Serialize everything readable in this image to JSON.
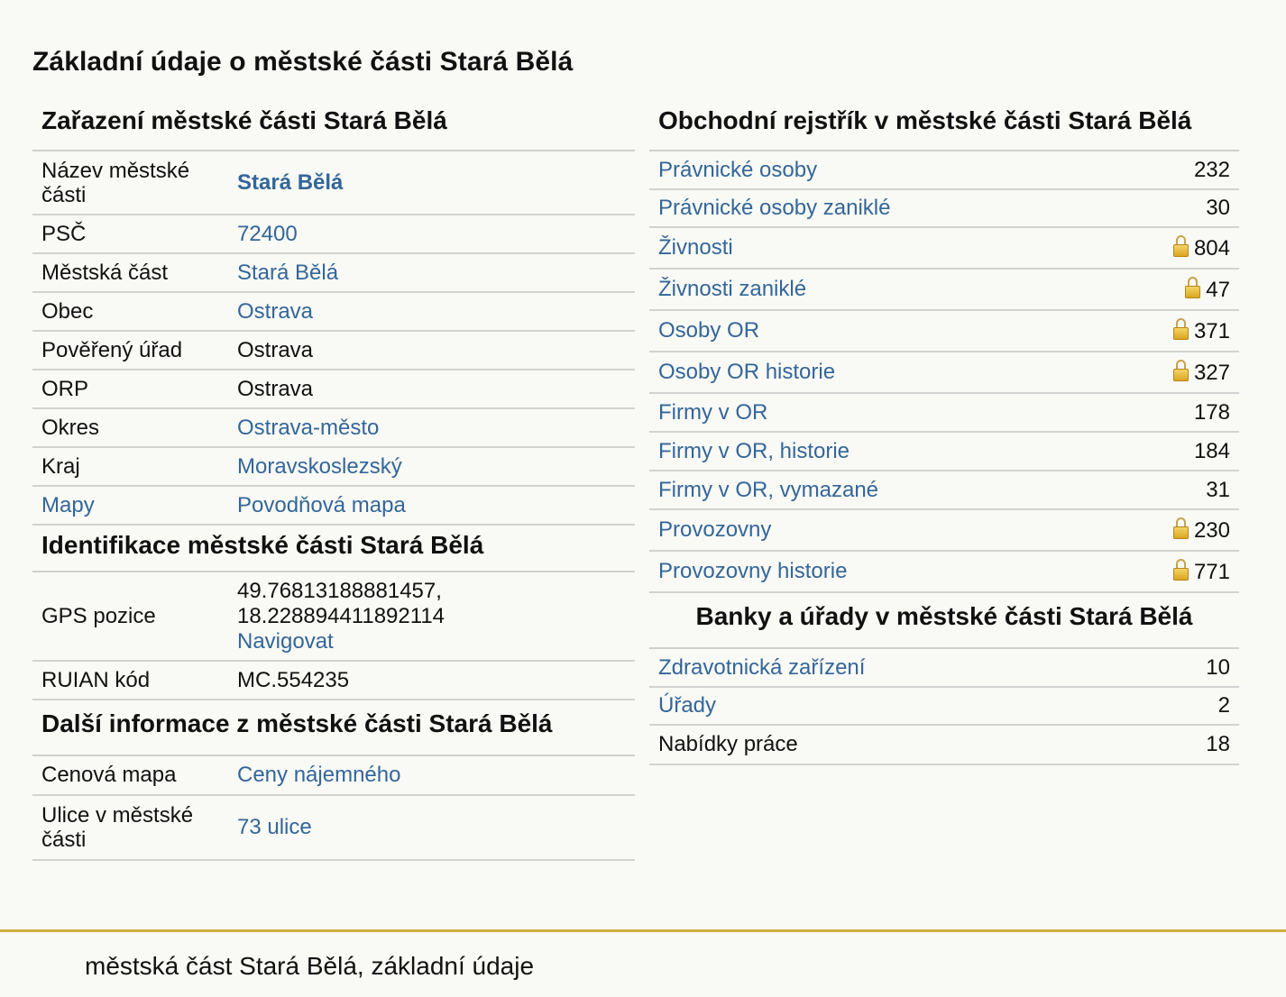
{
  "page_title": "Základní údaje o městské části Stará Bělá",
  "zarazeni": {
    "title": "Zařazení městské části Stará Bělá",
    "rows": [
      {
        "label": "Název městské části",
        "value": "Stará Bělá",
        "label_link": false,
        "value_link": true,
        "bold": true
      },
      {
        "label": "PSČ",
        "value": "72400",
        "label_link": false,
        "value_link": true
      },
      {
        "label": "Městská část",
        "value": "Stará Bělá",
        "label_link": false,
        "value_link": true
      },
      {
        "label": "Obec",
        "value": "Ostrava",
        "label_link": false,
        "value_link": true
      },
      {
        "label": "Pověřený úřad",
        "value": "Ostrava",
        "label_link": false,
        "value_link": false
      },
      {
        "label": "ORP",
        "value": "Ostrava",
        "label_link": false,
        "value_link": false
      },
      {
        "label": "Okres",
        "value": "Ostrava-město",
        "label_link": false,
        "value_link": true
      },
      {
        "label": "Kraj",
        "value": "Moravskoslezský",
        "label_link": false,
        "value_link": true
      },
      {
        "label": "Mapy",
        "value": "Povodňová mapa",
        "label_link": true,
        "value_link": true
      }
    ]
  },
  "identifikace": {
    "title": "Identifikace městské části Stará Bělá",
    "gps_label": "GPS pozice",
    "gps_lat": "49.76813188881457,",
    "gps_lon": "18.228894411892114",
    "navigate_label": "Navigovat",
    "ruian_label": "RUIAN kód",
    "ruian_value": "MC.554235"
  },
  "dalsi": {
    "title": "Další informace z městské části Stará Bělá",
    "rows": [
      {
        "label": "Cenová mapa",
        "value": "Ceny nájemného"
      },
      {
        "label": "Ulice v městské části",
        "value": "73 ulice"
      }
    ]
  },
  "rejstrik": {
    "title": "Obchodní rejstřík v městské části Stará Bělá",
    "rows": [
      {
        "label": "Právnické osoby",
        "count": "232",
        "locked": false
      },
      {
        "label": "Právnické osoby zaniklé",
        "count": "30",
        "locked": false
      },
      {
        "label": "Živnosti",
        "count": "804",
        "locked": true
      },
      {
        "label": "Živnosti zaniklé",
        "count": "47",
        "locked": true
      },
      {
        "label": "Osoby OR",
        "count": "371",
        "locked": true
      },
      {
        "label": "Osoby OR historie",
        "count": "327",
        "locked": true
      },
      {
        "label": "Firmy v OR",
        "count": "178",
        "locked": false
      },
      {
        "label": "Firmy v OR, historie",
        "count": "184",
        "locked": false
      },
      {
        "label": "Firmy v OR, vymazané",
        "count": "31",
        "locked": false
      },
      {
        "label": "Provozovny",
        "count": "230",
        "locked": true
      },
      {
        "label": "Provozovny historie",
        "count": "771",
        "locked": true
      }
    ]
  },
  "banky": {
    "title": "Banky a úřady v městské části Stará Bělá",
    "rows": [
      {
        "label": "Zdravotnická zařízení",
        "count": "10",
        "link": true
      },
      {
        "label": "Úřady",
        "count": "2",
        "link": true
      },
      {
        "label": "Nabídky práce",
        "count": "18",
        "link": false
      }
    ]
  },
  "footer": {
    "text": "městská část Stará Bělá, základní údaje",
    "accent_color": "#d1ad3e"
  },
  "colors": {
    "link": "#336699",
    "background": "#f9f9f5",
    "row_border": "#d2d2d2"
  }
}
